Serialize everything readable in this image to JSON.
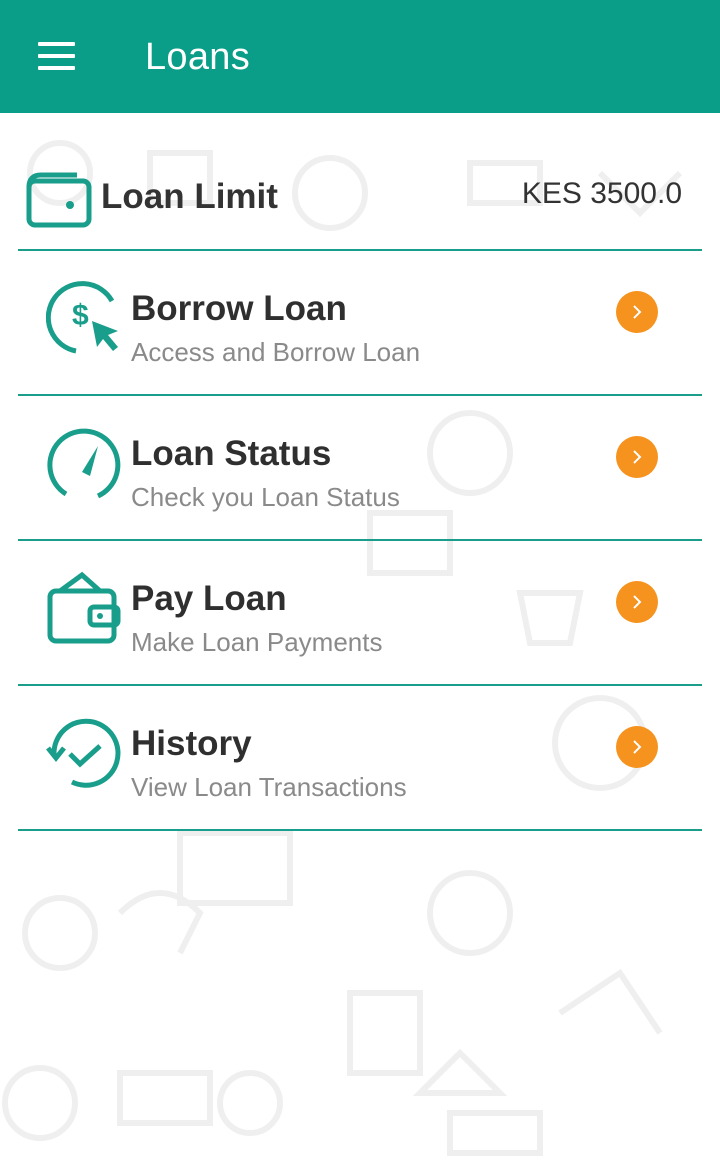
{
  "appbar": {
    "title": "Loans",
    "menu_icon": "hamburger-menu-icon",
    "color": "#0a9e88"
  },
  "loan_limit": {
    "label": "Loan Limit",
    "value": "KES 3500.0",
    "icon": "wallet-icon"
  },
  "menu": [
    {
      "title": "Borrow Loan",
      "subtitle": "Access and Borrow Loan",
      "icon": "dollar-cursor-icon"
    },
    {
      "title": "Loan Status",
      "subtitle": "Check you Loan Status",
      "icon": "gauge-icon"
    },
    {
      "title": "Pay Loan",
      "subtitle": "Make Loan Payments",
      "icon": "wallet-icon"
    },
    {
      "title": "History",
      "subtitle": "View Loan Transactions",
      "icon": "history-check-icon"
    }
  ],
  "colors": {
    "accent": "#1a9e8c",
    "chevron": "#f6921e"
  }
}
